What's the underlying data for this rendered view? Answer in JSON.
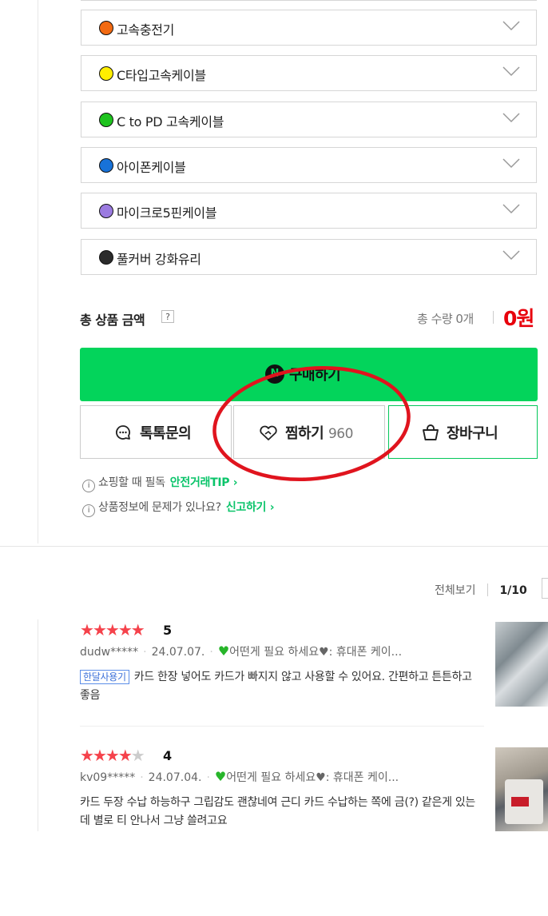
{
  "options": [
    {
      "label": "고속충전기",
      "color": "#f26a12"
    },
    {
      "label": "C타입고속케이블",
      "color": "#ffee00"
    },
    {
      "label": "C to PD 고속케이블",
      "color": "#1ec31e"
    },
    {
      "label": "아이폰케이블",
      "color": "#1872d8"
    },
    {
      "label": "마이크로5핀케이블",
      "color": "#9b7be0"
    },
    {
      "label": "풀커버 강화유리",
      "color": "#2b2b2b"
    }
  ],
  "total": {
    "label": "총 상품 금액",
    "help": "?",
    "quantity": "총 수량 0개",
    "price": "0원"
  },
  "actions": {
    "buy": "구매하기",
    "buy_icon": "N",
    "inquiry": "톡톡문의",
    "wish": "찜하기",
    "wish_count": "960",
    "cart": "장바구니"
  },
  "info": {
    "line1_text": "쇼핑할 때 필독",
    "line1_link": "안전거래TIP ›",
    "line2_text": "상품정보에 문제가 있나요?",
    "line2_link": "신고하기 ›"
  },
  "reviews_header": {
    "view_all": "전체보기",
    "page": "1/10"
  },
  "reviews": [
    {
      "stars": 5,
      "score": "5",
      "user": "dudw*****",
      "date": "24.07.07.",
      "option": "어떤게 필요 하세요♥: 휴대폰 케이...",
      "badge": "한달사용기",
      "text": "카드 한장 넣어도 카드가 빠지지 않고 사용할 수 있어요. 간편하고 튼튼하고 좋음"
    },
    {
      "stars": 4,
      "score": "4",
      "user": "kv09*****",
      "date": "24.07.04.",
      "option": "어떤게 필요 하세요♥: 휴대폰 케이...",
      "badge": "",
      "text": "카드 두장 수납 하능하구 그립감도 괜찮네여 근디 카드 수납하는 쪽에 금(?) 같은게 있는데 별로 티 안나서 그냥 쓸려고요"
    }
  ],
  "colors": {
    "accent_green": "#03d45b",
    "price_red": "#e8000c",
    "annotation_red": "#e0141e"
  },
  "annotation": "red-circle-around-wish-button"
}
